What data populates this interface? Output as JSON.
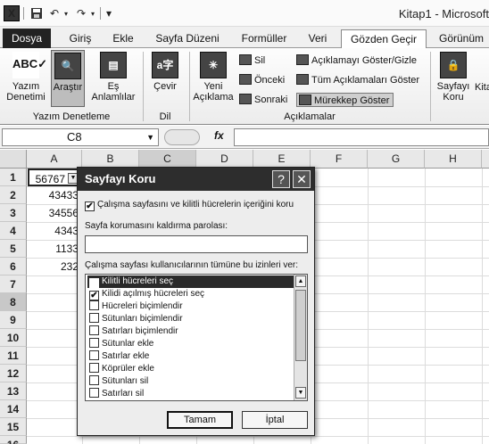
{
  "window": {
    "title": "Kitap1 - Microsoft",
    "app_icon_label": "X",
    "undo_glyph": "↶",
    "redo_glyph": "↷",
    "customize_glyph": "▾"
  },
  "tabs": [
    "Dosya",
    "Giriş",
    "Ekle",
    "Sayfa Düzeni",
    "Formüller",
    "Veri",
    "Gözden Geçir",
    "Görünüm"
  ],
  "active_tab": "Gözden Geçir",
  "ribbon": {
    "proofing": {
      "spelling": "Yazım Denetimi",
      "research": "Araştır",
      "thesaurus": "Eş Anlamlılar",
      "group_label": "Yazım Denetleme"
    },
    "language": {
      "translate": "Çevir",
      "group_label": "Dil"
    },
    "comments": {
      "new_comment": "Yeni Açıklama",
      "delete": "Sil",
      "previous": "Önceki",
      "next": "Sonraki",
      "show_hide": "Açıklamayı Göster/Gizle",
      "show_all": "Tüm Açıklamaları Göster",
      "show_ink": "Mürekkep Göster",
      "group_label": "Açıklamalar"
    },
    "changes": {
      "protect_sheet": "Sayfayı Koru",
      "protect_workbook_partial": "Kita"
    }
  },
  "formula_bar": {
    "name_box": "C8",
    "fx": "fx",
    "value": ""
  },
  "columns": [
    "A",
    "B",
    "C",
    "D",
    "E",
    "F",
    "G",
    "H"
  ],
  "selected_column": "C",
  "rows": [
    "1",
    "2",
    "3",
    "4",
    "5",
    "6",
    "7",
    "8",
    "9",
    "10",
    "11",
    "12",
    "13",
    "14",
    "15",
    "16"
  ],
  "selected_row": "8",
  "cells_A": [
    "56767",
    "43433",
    "34556",
    "4343",
    "1133",
    "232"
  ],
  "dialog": {
    "title": "Sayfayı Koru",
    "help_glyph": "?",
    "close_glyph": "✕",
    "protect_contents_label": "Çalışma sayfasını ve kilitli hücrelerin içeriğini koru",
    "protect_contents_checked": true,
    "password_label": "Sayfa korumasını kaldırma parolası:",
    "password_value": "",
    "permissions_label": "Çalışma sayfası kullanıcılarının tümüne bu izinleri ver:",
    "permissions": [
      {
        "label": "Kilitli hücreleri seç",
        "checked": true
      },
      {
        "label": "Kilidi açılmış hücreleri seç",
        "checked": true
      },
      {
        "label": "Hücreleri biçimlendir",
        "checked": false
      },
      {
        "label": "Sütunları biçimlendir",
        "checked": false
      },
      {
        "label": "Satırları biçimlendir",
        "checked": false
      },
      {
        "label": "Sütunlar ekle",
        "checked": false
      },
      {
        "label": "Satırlar ekle",
        "checked": false
      },
      {
        "label": "Köprüler ekle",
        "checked": false
      },
      {
        "label": "Sütunları sil",
        "checked": false
      },
      {
        "label": "Satırları sil",
        "checked": false
      }
    ],
    "selected_permission_index": 0,
    "ok": "Tamam",
    "cancel": "İptal",
    "check_glyph": "✔",
    "scroll_up": "▲",
    "scroll_down": "▼"
  }
}
